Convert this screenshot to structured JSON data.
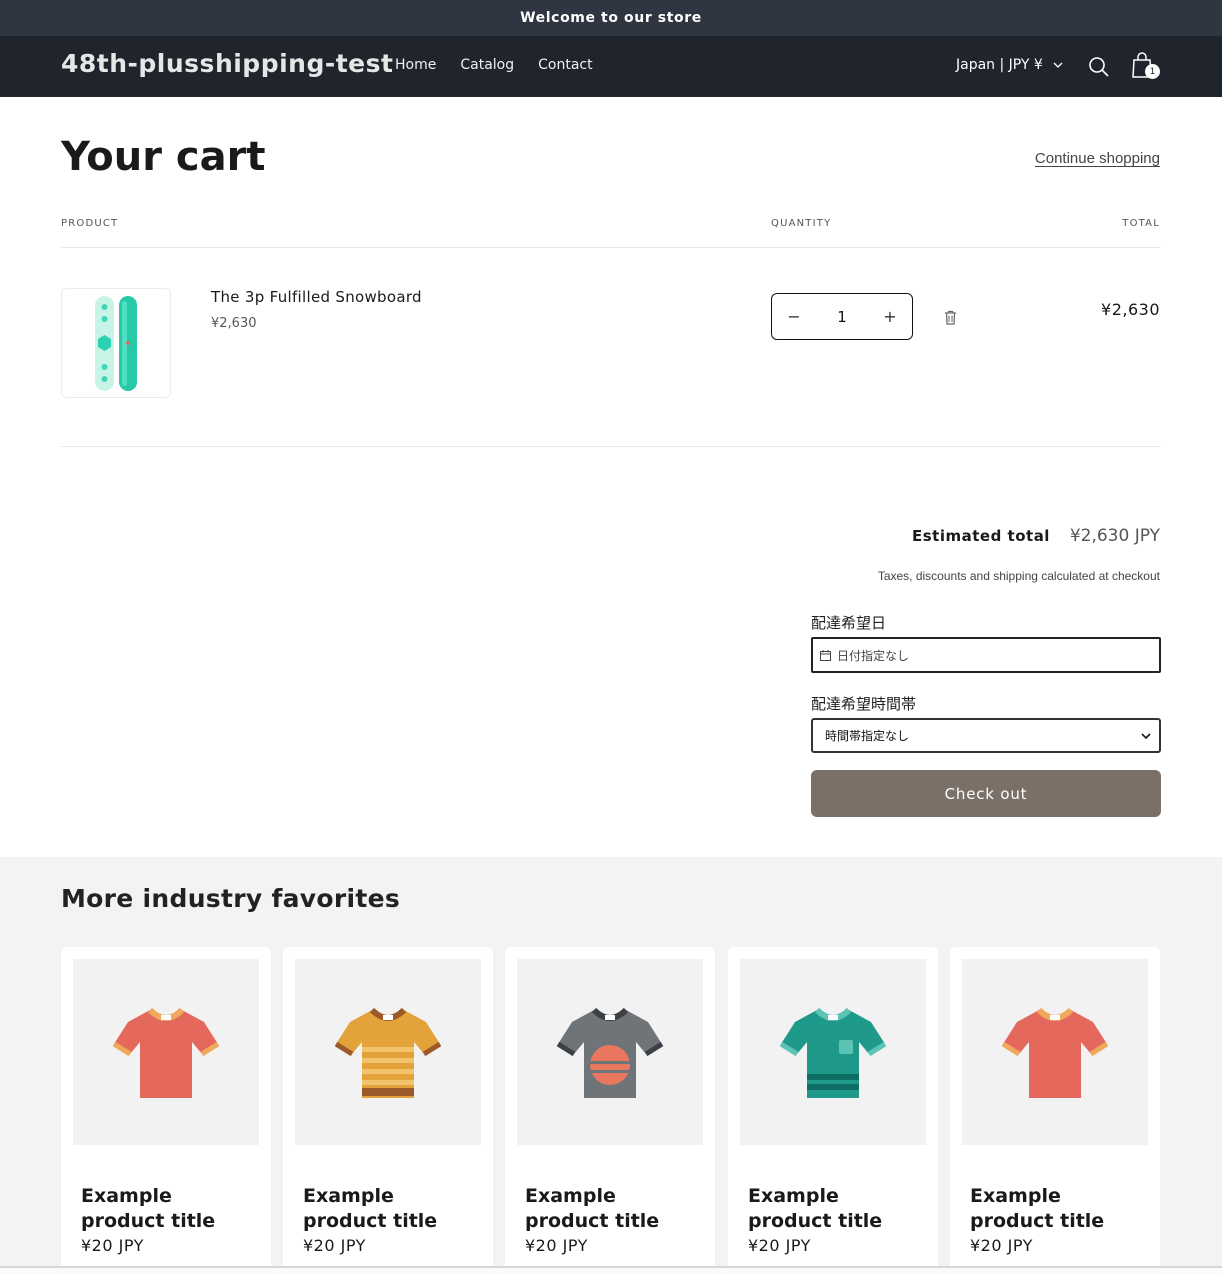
{
  "announcement": {
    "text": "Welcome to our store"
  },
  "header": {
    "logo": "48th-plusshipping-test",
    "nav": [
      "Home",
      "Catalog",
      "Contact"
    ],
    "locale": "Japan | JPY ¥",
    "cart_count": "1"
  },
  "cart": {
    "title": "Your cart",
    "continue_label": "Continue shopping",
    "col_product": "PRODUCT",
    "col_quantity": "QUANTITY",
    "col_total": "TOTAL",
    "item": {
      "name": "The 3p Fulfilled Snowboard",
      "price": "¥2,630",
      "quantity": "1",
      "line_total": "¥2,630",
      "minus": "−",
      "plus": "+"
    },
    "estimated_total_label": "Estimated total",
    "estimated_total_value": "¥2,630 JPY",
    "tax_note": "Taxes, discounts and shipping calculated at checkout",
    "delivery_date_label": "配達希望日",
    "delivery_date_placeholder": "日付指定なし",
    "delivery_time_label": "配達希望時間帯",
    "delivery_time_value": "時間帯指定なし",
    "checkout_label": "Check out"
  },
  "recommendations": {
    "title": "More industry favorites",
    "products": [
      {
        "title": "Example product title",
        "price": "¥20 JPY",
        "shirt_color": "#e5685c",
        "collar_color": "#f0a95a",
        "style": "plain"
      },
      {
        "title": "Example product title",
        "price": "¥20 JPY",
        "shirt_color": "#e3a33a",
        "collar_color": "#9b5a2a",
        "style": "striped"
      },
      {
        "title": "Example product title",
        "price": "¥20 JPY",
        "shirt_color": "#6f7479",
        "collar_color": "#3d4146",
        "style": "sunset"
      },
      {
        "title": "Example product title",
        "price": "¥20 JPY",
        "shirt_color": "#1f9a8a",
        "collar_color": "#5cc4b5",
        "style": "pocket"
      },
      {
        "title": "Example product title",
        "price": "¥20 JPY",
        "shirt_color": "#e5685c",
        "collar_color": "#f0a95a",
        "style": "plain"
      }
    ]
  },
  "colors": {
    "checkout_bg": "#7a7068",
    "header_bg": "#1f242d",
    "announcement_bg": "#2f3541"
  }
}
